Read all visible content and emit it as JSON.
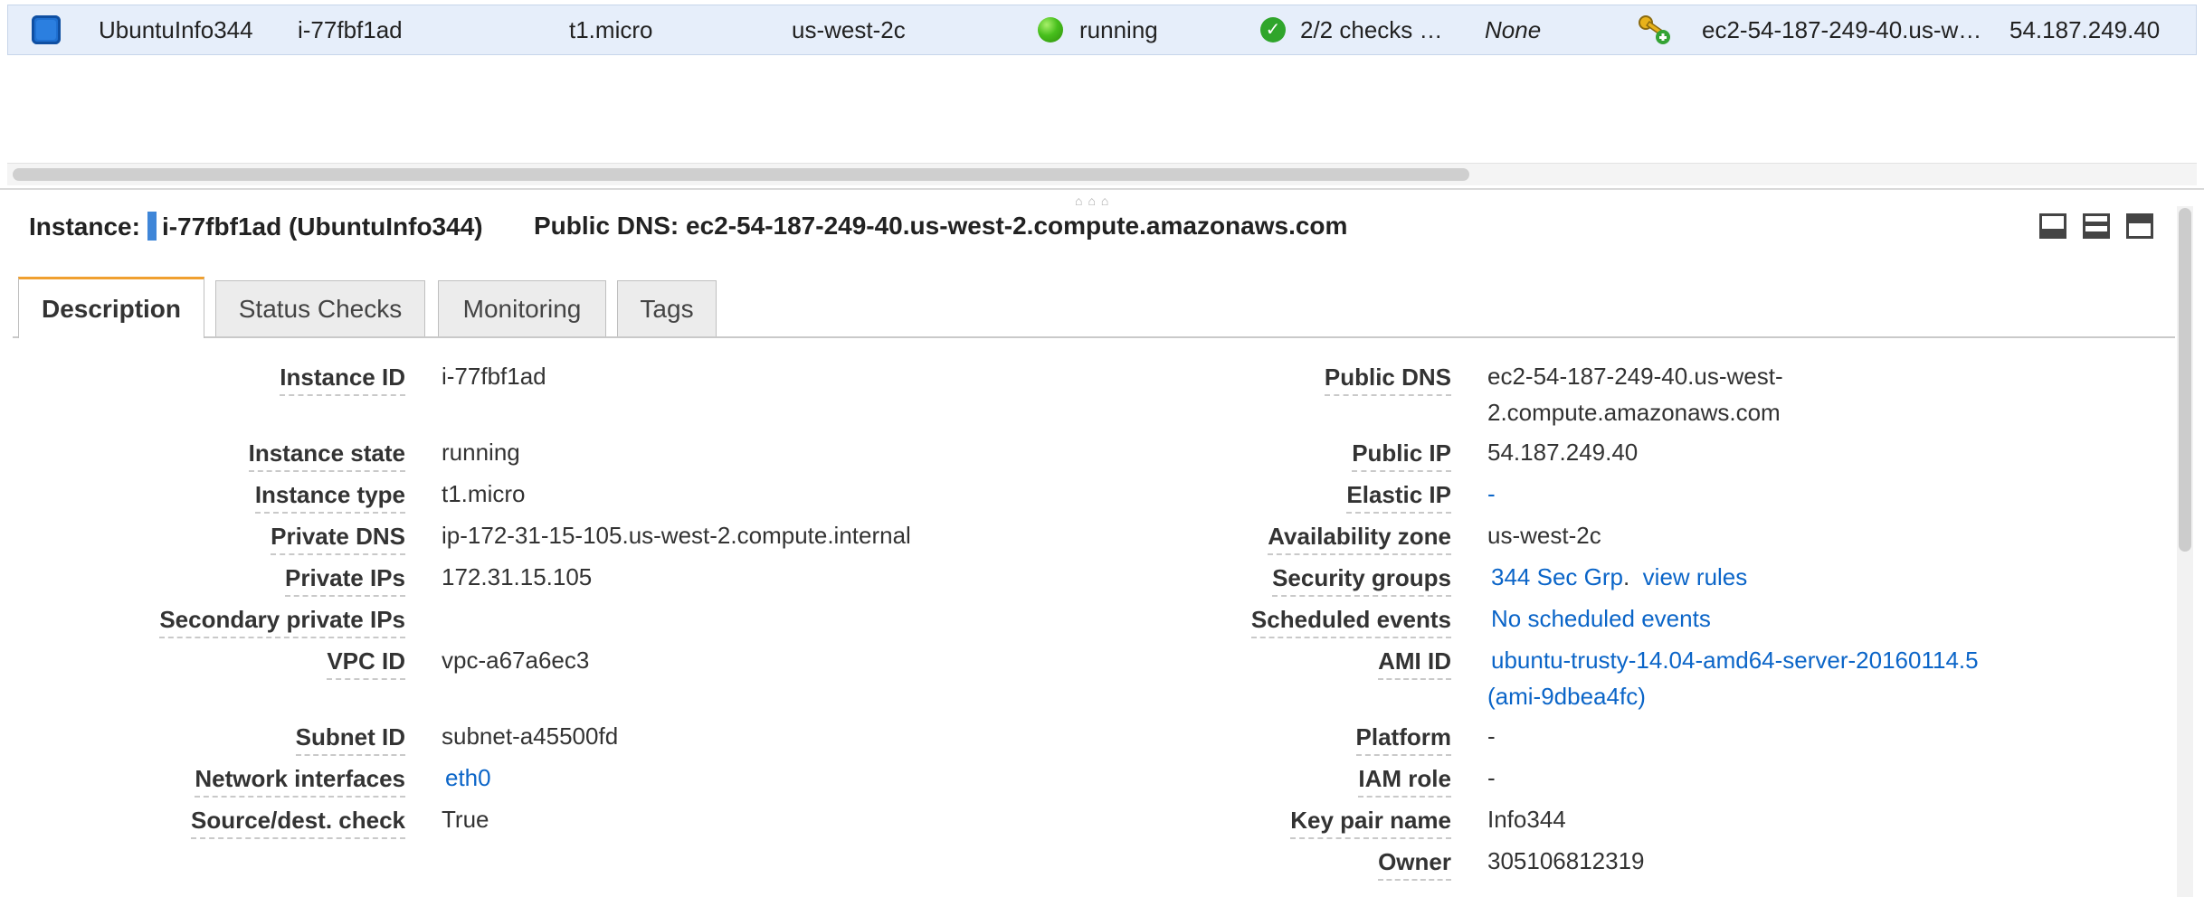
{
  "instance_row": {
    "name": "UbuntuInfo344",
    "instance_id": "i-77fbf1ad",
    "instance_type": "t1.micro",
    "availability_zone": "us-west-2c",
    "instance_state": "running",
    "status_checks": "2/2 checks …",
    "alarm_status": "None",
    "public_dns": "ec2-54-187-249-40.us-w…",
    "public_ip": "54.187.249.40"
  },
  "header": {
    "instance_label": "Instance:",
    "instance_value": "i-77fbf1ad (UbuntuInfo344)",
    "dns_label": "Public DNS:",
    "dns_value": "ec2-54-187-249-40.us-west-2.compute.amazonaws.com"
  },
  "tabs": [
    {
      "label": "Description",
      "active": true
    },
    {
      "label": "Status Checks",
      "active": false
    },
    {
      "label": "Monitoring",
      "active": false
    },
    {
      "label": "Tags",
      "active": false
    }
  ],
  "description": {
    "left": [
      {
        "label": "Instance ID",
        "value": "i-77fbf1ad"
      },
      {
        "label": "Instance state",
        "value": "running"
      },
      {
        "label": "Instance type",
        "value": "t1.micro"
      },
      {
        "label": "Private DNS",
        "value": "ip-172-31-15-105.us-west-2.compute.internal"
      },
      {
        "label": "Private IPs",
        "value": "172.31.15.105"
      },
      {
        "label": "Secondary private IPs",
        "value": ""
      },
      {
        "label": "VPC ID",
        "value": "vpc-a67a6ec3"
      },
      {
        "label": "Subnet ID",
        "value": "subnet-a45500fd"
      },
      {
        "label": "Network interfaces",
        "value": "eth0"
      },
      {
        "label": "Source/dest. check",
        "value": "True"
      }
    ],
    "right": [
      {
        "label": "Public DNS",
        "value_line1": "ec2-54-187-249-40.us-west-",
        "value_line2": "2.compute.amazonaws.com"
      },
      {
        "label": "Public IP",
        "value": "54.187.249.40"
      },
      {
        "label": "Elastic IP",
        "value": "-"
      },
      {
        "label": "Availability zone",
        "value": "us-west-2c"
      },
      {
        "label": "Security groups",
        "value": "344 Sec Grp",
        "separator": ".",
        "link2": "view rules"
      },
      {
        "label": "Scheduled events",
        "value": "No scheduled events"
      },
      {
        "label": "AMI ID",
        "value_line1": "ubuntu-trusty-14.04-amd64-server-20160114.5",
        "value_line2": "(ami-9dbea4fc)"
      },
      {
        "label": "Platform",
        "value": "-"
      },
      {
        "label": "IAM role",
        "value": "-"
      },
      {
        "label": "Key pair name",
        "value": "Info344"
      },
      {
        "label": "Owner",
        "value": "305106812319"
      }
    ]
  },
  "colors": {
    "selected_row_bg": "#e6eefa",
    "link": "#0b65c8",
    "active_tab_accent": "#f0a030",
    "running_green": "#47bf1c"
  },
  "icons": {
    "checkbox": "checkbox-checked-icon",
    "state": "green-dot-icon",
    "checks": "check-circle-icon",
    "alarm": "key-alarm-icon"
  }
}
